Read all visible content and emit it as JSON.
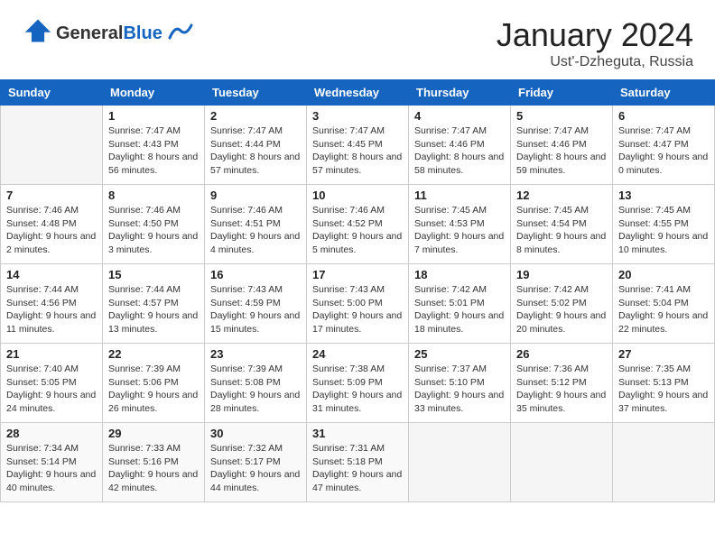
{
  "header": {
    "logo_general": "General",
    "logo_blue": "Blue",
    "title": "January 2024",
    "location": "Ust'-Dzheguta, Russia"
  },
  "weekdays": [
    "Sunday",
    "Monday",
    "Tuesday",
    "Wednesday",
    "Thursday",
    "Friday",
    "Saturday"
  ],
  "weeks": [
    [
      {
        "day": "",
        "sunrise": "",
        "sunset": "",
        "daylight": ""
      },
      {
        "day": "1",
        "sunrise": "Sunrise: 7:47 AM",
        "sunset": "Sunset: 4:43 PM",
        "daylight": "Daylight: 8 hours and 56 minutes."
      },
      {
        "day": "2",
        "sunrise": "Sunrise: 7:47 AM",
        "sunset": "Sunset: 4:44 PM",
        "daylight": "Daylight: 8 hours and 57 minutes."
      },
      {
        "day": "3",
        "sunrise": "Sunrise: 7:47 AM",
        "sunset": "Sunset: 4:45 PM",
        "daylight": "Daylight: 8 hours and 57 minutes."
      },
      {
        "day": "4",
        "sunrise": "Sunrise: 7:47 AM",
        "sunset": "Sunset: 4:46 PM",
        "daylight": "Daylight: 8 hours and 58 minutes."
      },
      {
        "day": "5",
        "sunrise": "Sunrise: 7:47 AM",
        "sunset": "Sunset: 4:46 PM",
        "daylight": "Daylight: 8 hours and 59 minutes."
      },
      {
        "day": "6",
        "sunrise": "Sunrise: 7:47 AM",
        "sunset": "Sunset: 4:47 PM",
        "daylight": "Daylight: 9 hours and 0 minutes."
      }
    ],
    [
      {
        "day": "7",
        "sunrise": "Sunrise: 7:46 AM",
        "sunset": "Sunset: 4:48 PM",
        "daylight": "Daylight: 9 hours and 2 minutes."
      },
      {
        "day": "8",
        "sunrise": "Sunrise: 7:46 AM",
        "sunset": "Sunset: 4:50 PM",
        "daylight": "Daylight: 9 hours and 3 minutes."
      },
      {
        "day": "9",
        "sunrise": "Sunrise: 7:46 AM",
        "sunset": "Sunset: 4:51 PM",
        "daylight": "Daylight: 9 hours and 4 minutes."
      },
      {
        "day": "10",
        "sunrise": "Sunrise: 7:46 AM",
        "sunset": "Sunset: 4:52 PM",
        "daylight": "Daylight: 9 hours and 5 minutes."
      },
      {
        "day": "11",
        "sunrise": "Sunrise: 7:45 AM",
        "sunset": "Sunset: 4:53 PM",
        "daylight": "Daylight: 9 hours and 7 minutes."
      },
      {
        "day": "12",
        "sunrise": "Sunrise: 7:45 AM",
        "sunset": "Sunset: 4:54 PM",
        "daylight": "Daylight: 9 hours and 8 minutes."
      },
      {
        "day": "13",
        "sunrise": "Sunrise: 7:45 AM",
        "sunset": "Sunset: 4:55 PM",
        "daylight": "Daylight: 9 hours and 10 minutes."
      }
    ],
    [
      {
        "day": "14",
        "sunrise": "Sunrise: 7:44 AM",
        "sunset": "Sunset: 4:56 PM",
        "daylight": "Daylight: 9 hours and 11 minutes."
      },
      {
        "day": "15",
        "sunrise": "Sunrise: 7:44 AM",
        "sunset": "Sunset: 4:57 PM",
        "daylight": "Daylight: 9 hours and 13 minutes."
      },
      {
        "day": "16",
        "sunrise": "Sunrise: 7:43 AM",
        "sunset": "Sunset: 4:59 PM",
        "daylight": "Daylight: 9 hours and 15 minutes."
      },
      {
        "day": "17",
        "sunrise": "Sunrise: 7:43 AM",
        "sunset": "Sunset: 5:00 PM",
        "daylight": "Daylight: 9 hours and 17 minutes."
      },
      {
        "day": "18",
        "sunrise": "Sunrise: 7:42 AM",
        "sunset": "Sunset: 5:01 PM",
        "daylight": "Daylight: 9 hours and 18 minutes."
      },
      {
        "day": "19",
        "sunrise": "Sunrise: 7:42 AM",
        "sunset": "Sunset: 5:02 PM",
        "daylight": "Daylight: 9 hours and 20 minutes."
      },
      {
        "day": "20",
        "sunrise": "Sunrise: 7:41 AM",
        "sunset": "Sunset: 5:04 PM",
        "daylight": "Daylight: 9 hours and 22 minutes."
      }
    ],
    [
      {
        "day": "21",
        "sunrise": "Sunrise: 7:40 AM",
        "sunset": "Sunset: 5:05 PM",
        "daylight": "Daylight: 9 hours and 24 minutes."
      },
      {
        "day": "22",
        "sunrise": "Sunrise: 7:39 AM",
        "sunset": "Sunset: 5:06 PM",
        "daylight": "Daylight: 9 hours and 26 minutes."
      },
      {
        "day": "23",
        "sunrise": "Sunrise: 7:39 AM",
        "sunset": "Sunset: 5:08 PM",
        "daylight": "Daylight: 9 hours and 28 minutes."
      },
      {
        "day": "24",
        "sunrise": "Sunrise: 7:38 AM",
        "sunset": "Sunset: 5:09 PM",
        "daylight": "Daylight: 9 hours and 31 minutes."
      },
      {
        "day": "25",
        "sunrise": "Sunrise: 7:37 AM",
        "sunset": "Sunset: 5:10 PM",
        "daylight": "Daylight: 9 hours and 33 minutes."
      },
      {
        "day": "26",
        "sunrise": "Sunrise: 7:36 AM",
        "sunset": "Sunset: 5:12 PM",
        "daylight": "Daylight: 9 hours and 35 minutes."
      },
      {
        "day": "27",
        "sunrise": "Sunrise: 7:35 AM",
        "sunset": "Sunset: 5:13 PM",
        "daylight": "Daylight: 9 hours and 37 minutes."
      }
    ],
    [
      {
        "day": "28",
        "sunrise": "Sunrise: 7:34 AM",
        "sunset": "Sunset: 5:14 PM",
        "daylight": "Daylight: 9 hours and 40 minutes."
      },
      {
        "day": "29",
        "sunrise": "Sunrise: 7:33 AM",
        "sunset": "Sunset: 5:16 PM",
        "daylight": "Daylight: 9 hours and 42 minutes."
      },
      {
        "day": "30",
        "sunrise": "Sunrise: 7:32 AM",
        "sunset": "Sunset: 5:17 PM",
        "daylight": "Daylight: 9 hours and 44 minutes."
      },
      {
        "day": "31",
        "sunrise": "Sunrise: 7:31 AM",
        "sunset": "Sunset: 5:18 PM",
        "daylight": "Daylight: 9 hours and 47 minutes."
      },
      {
        "day": "",
        "sunrise": "",
        "sunset": "",
        "daylight": ""
      },
      {
        "day": "",
        "sunrise": "",
        "sunset": "",
        "daylight": ""
      },
      {
        "day": "",
        "sunrise": "",
        "sunset": "",
        "daylight": ""
      }
    ]
  ]
}
